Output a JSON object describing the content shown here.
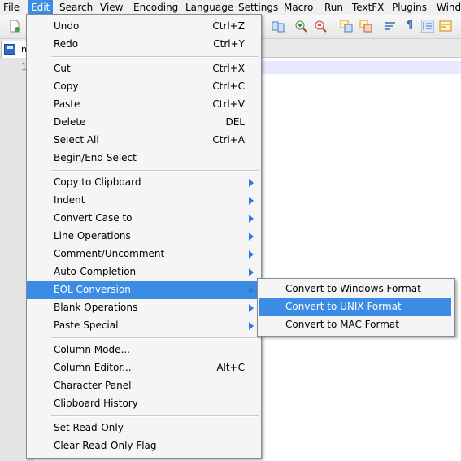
{
  "menubar": {
    "items": [
      "File",
      "Edit",
      "Search",
      "View",
      "Encoding",
      "Language",
      "Settings",
      "Macro",
      "Run",
      "TextFX",
      "Plugins",
      "Wind"
    ]
  },
  "tab": {
    "name": "n"
  },
  "editor": {
    "line_number": "1"
  },
  "edit_menu": {
    "items": [
      {
        "label": "Undo",
        "shortcut": "Ctrl+Z"
      },
      {
        "label": "Redo",
        "shortcut": "Ctrl+Y"
      },
      {
        "label": "Cut",
        "shortcut": "Ctrl+X"
      },
      {
        "label": "Copy",
        "shortcut": "Ctrl+C"
      },
      {
        "label": "Paste",
        "shortcut": "Ctrl+V"
      },
      {
        "label": "Delete",
        "shortcut": "DEL"
      },
      {
        "label": "Select All",
        "shortcut": "Ctrl+A"
      },
      {
        "label": "Begin/End Select",
        "shortcut": ""
      },
      {
        "label": "Copy to Clipboard",
        "submenu": true
      },
      {
        "label": "Indent",
        "submenu": true
      },
      {
        "label": "Convert Case to",
        "submenu": true
      },
      {
        "label": "Line Operations",
        "submenu": true
      },
      {
        "label": "Comment/Uncomment",
        "submenu": true
      },
      {
        "label": "Auto-Completion",
        "submenu": true
      },
      {
        "label": "EOL Conversion",
        "submenu": true,
        "highlighted": true
      },
      {
        "label": "Blank Operations",
        "submenu": true
      },
      {
        "label": "Paste Special",
        "submenu": true
      },
      {
        "label": "Column Mode...",
        "shortcut": ""
      },
      {
        "label": "Column Editor...",
        "shortcut": "Alt+C"
      },
      {
        "label": "Character Panel",
        "shortcut": ""
      },
      {
        "label": "Clipboard History",
        "shortcut": ""
      },
      {
        "label": "Set Read-Only",
        "shortcut": ""
      },
      {
        "label": "Clear Read-Only Flag",
        "shortcut": ""
      }
    ]
  },
  "eol_submenu": {
    "items": [
      {
        "label": "Convert to Windows Format"
      },
      {
        "label": "Convert to UNIX Format",
        "highlighted": true
      },
      {
        "label": "Convert to MAC Format"
      }
    ]
  },
  "colors": {
    "highlight": "#3c8be4",
    "arrow": "#2f79d8",
    "menu_bg": "#f5f5f5"
  },
  "icons": [
    "new-file-icon",
    "zoom-in-icon",
    "zoom-out-icon",
    "sync-scroll-icon",
    "word-wrap-icon",
    "show-all-chars-icon",
    "indent-guide-icon",
    "save-icon",
    "submenu-arrow-icon"
  ]
}
